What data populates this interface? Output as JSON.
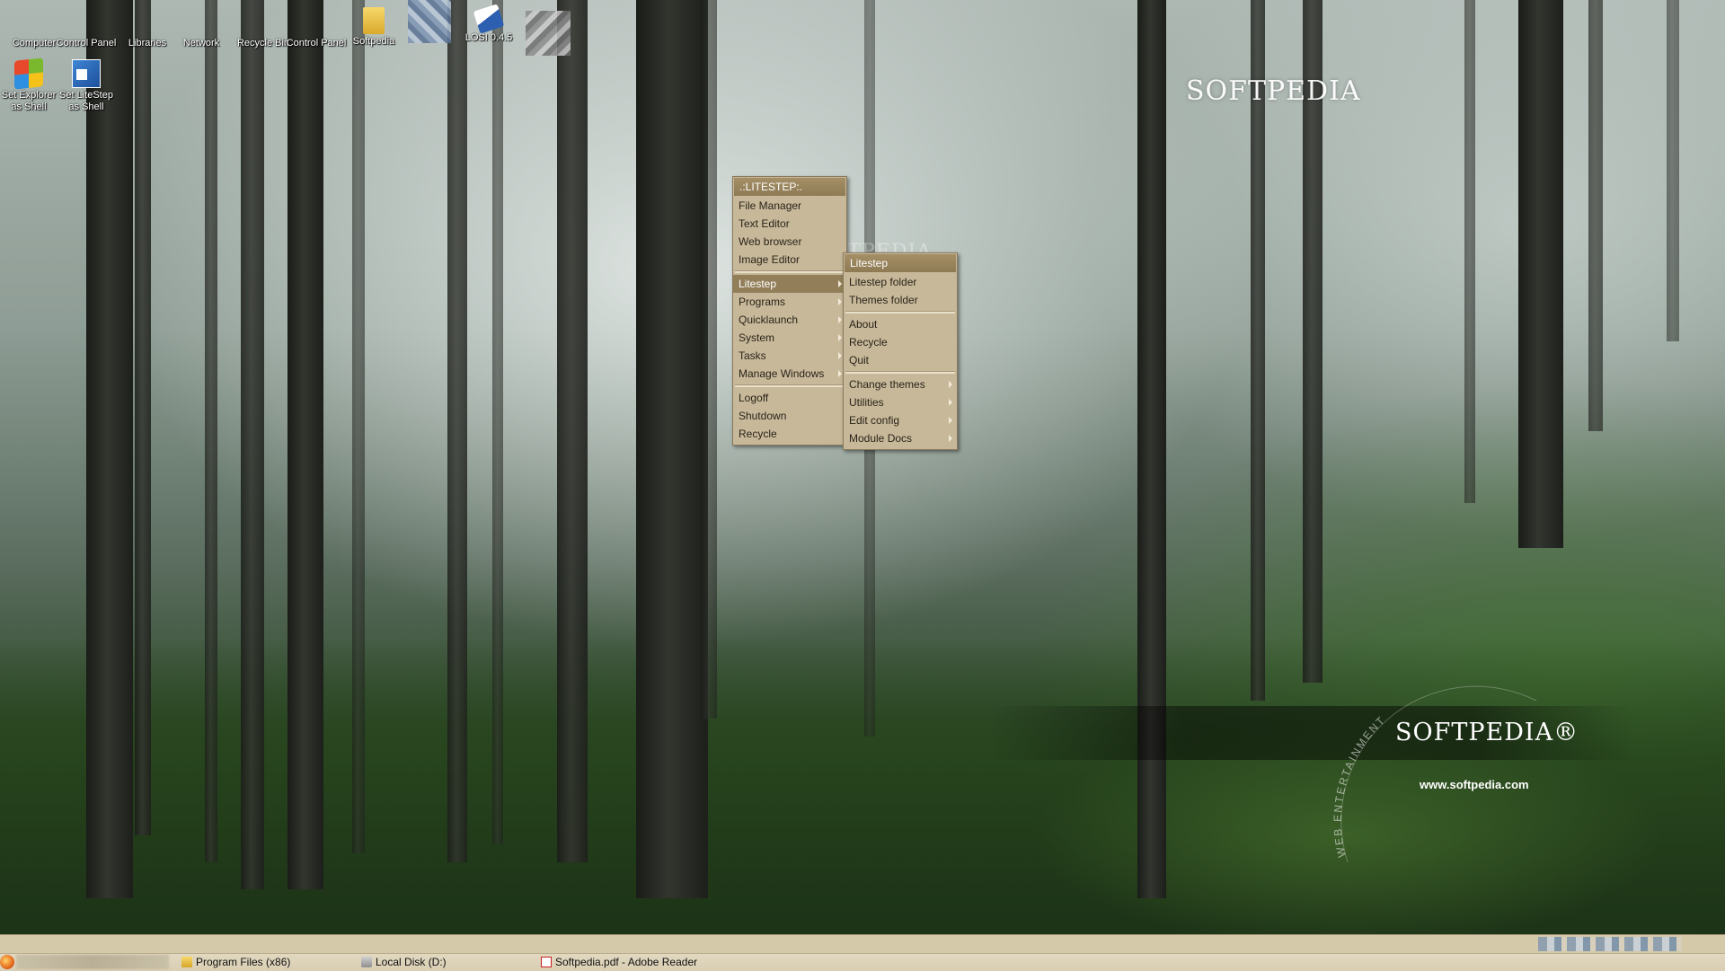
{
  "desktop_icons": [
    {
      "id": "computer",
      "label": "Computer",
      "icon": "computer-icon"
    },
    {
      "id": "control-panel",
      "label": "Control Panel",
      "icon": "control-panel-icon"
    },
    {
      "id": "libraries",
      "label": "Libraries",
      "icon": "libraries-icon"
    },
    {
      "id": "network",
      "label": "Network",
      "icon": "network-icon"
    },
    {
      "id": "recycle-bin",
      "label": "Recycle Bin",
      "icon": "recycle-bin-icon"
    },
    {
      "id": "control-panel-2",
      "label": "Control Panel",
      "icon": "control-panel-icon"
    },
    {
      "id": "softpedia",
      "label": "Softpedia",
      "icon": "folder-icon"
    },
    {
      "id": "blurred-1",
      "label": "",
      "icon": "blurred-icon"
    },
    {
      "id": "losi",
      "label": "LOSI 0.4.5",
      "icon": "losi-icon"
    },
    {
      "id": "blurred-2",
      "label": "",
      "icon": "blurred-icon"
    }
  ],
  "shell_icons": [
    {
      "line1": "Set Explorer",
      "line2": "as Shell",
      "icon": "windows-logo-icon"
    },
    {
      "line1": "Set LiteStep",
      "line2": "as Shell",
      "icon": "litestep-icon"
    }
  ],
  "watermarks": {
    "top": "SOFTPEDIA",
    "mid": "SOFTPEDIA",
    "big": "SOFTPEDIA®",
    "url": "www.softpedia.com",
    "arc_text": "WEB ENTERTAINMENT"
  },
  "main_menu": {
    "title": ".:LITESTEP:.",
    "groups": [
      [
        {
          "label": "File Manager",
          "submenu": false
        },
        {
          "label": "Text Editor",
          "submenu": false
        },
        {
          "label": "Web browser",
          "submenu": false
        },
        {
          "label": "Image Editor",
          "submenu": false
        }
      ],
      [
        {
          "label": "Litestep",
          "submenu": true,
          "active": true
        },
        {
          "label": "Programs",
          "submenu": true
        },
        {
          "label": "Quicklaunch",
          "submenu": true
        },
        {
          "label": "System",
          "submenu": true
        },
        {
          "label": "Tasks",
          "submenu": true
        },
        {
          "label": "Manage Windows",
          "submenu": true
        }
      ],
      [
        {
          "label": "Logoff",
          "submenu": false
        },
        {
          "label": "Shutdown",
          "submenu": false
        },
        {
          "label": "Recycle",
          "submenu": false
        }
      ]
    ]
  },
  "sub_menu": {
    "title": "Litestep",
    "groups": [
      [
        {
          "label": "Litestep folder",
          "submenu": false
        },
        {
          "label": "Themes folder",
          "submenu": false
        }
      ],
      [
        {
          "label": "About",
          "submenu": false
        },
        {
          "label": "Recycle",
          "submenu": false
        },
        {
          "label": "Quit",
          "submenu": false
        }
      ],
      [
        {
          "label": "Change themes",
          "submenu": true
        },
        {
          "label": "Utilities",
          "submenu": true
        },
        {
          "label": "Edit config",
          "submenu": true
        },
        {
          "label": "Module Docs",
          "submenu": true
        }
      ]
    ]
  },
  "taskbar": {
    "tasks": [
      {
        "label": "Program Files (x86)",
        "icon": "folder-icon"
      },
      {
        "label": "Local Disk (D:)",
        "icon": "disk-icon"
      },
      {
        "label": "Softpedia.pdf - Adobe Reader",
        "icon": "pdf-icon"
      }
    ]
  }
}
